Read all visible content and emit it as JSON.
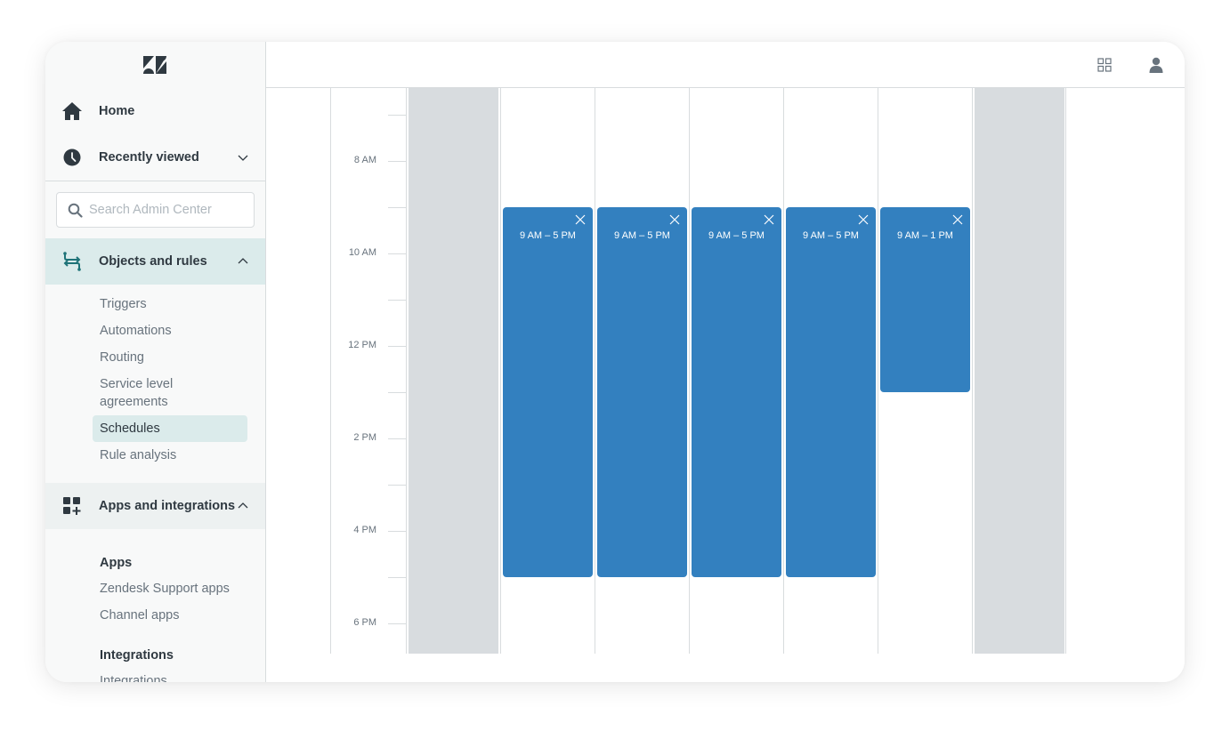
{
  "app": {
    "logo": "zendesk-logo",
    "colors": {
      "accent": "#3380bf",
      "sidebar_bg": "#f8f9f9",
      "active_section_bg": "#dbebeb",
      "off_day_bg": "#d8dcdf",
      "text_primary": "#2f3941",
      "text_secondary": "#68737d"
    }
  },
  "sidebar": {
    "home": {
      "label": "Home",
      "icon": "home-icon"
    },
    "recently_viewed": {
      "label": "Recently viewed",
      "icon": "clock-icon",
      "expanded": false
    },
    "search": {
      "placeholder": "Search Admin Center",
      "value": ""
    },
    "objects_and_rules": {
      "label": "Objects and rules",
      "icon": "objects-rules-icon",
      "expanded": true,
      "items": [
        {
          "label": "Triggers"
        },
        {
          "label": "Automations"
        },
        {
          "label": "Routing"
        },
        {
          "label": "Service level agreements"
        },
        {
          "label": "Schedules",
          "selected": true
        },
        {
          "label": "Rule analysis"
        }
      ]
    },
    "apps_and_integrations": {
      "label": "Apps and integrations",
      "icon": "apps-add-icon",
      "expanded": true,
      "groups": [
        {
          "heading": "Apps",
          "items": [
            {
              "label": "Zendesk Support apps"
            },
            {
              "label": "Channel apps"
            }
          ]
        },
        {
          "heading": "Integrations",
          "items": [
            {
              "label": "Integrations"
            }
          ]
        }
      ]
    }
  },
  "header": {
    "products_icon": "grid-icon",
    "profile_icon": "user-icon"
  },
  "calendar": {
    "hour_labels": [
      "8 AM",
      "10 AM",
      "12 PM",
      "2 PM",
      "4 PM",
      "6 PM"
    ],
    "visible_start_hour": 6.42,
    "days": [
      {
        "index": 0,
        "off": true
      },
      {
        "index": 1,
        "off": false
      },
      {
        "index": 2,
        "off": false
      },
      {
        "index": 3,
        "off": false
      },
      {
        "index": 4,
        "off": false
      },
      {
        "index": 5,
        "off": false
      },
      {
        "index": 6,
        "off": true
      }
    ],
    "events": [
      {
        "day": 1,
        "label": "9 AM – 5 PM",
        "start": 9,
        "end": 17
      },
      {
        "day": 2,
        "label": "9 AM – 5 PM",
        "start": 9,
        "end": 17
      },
      {
        "day": 3,
        "label": "9 AM – 5 PM",
        "start": 9,
        "end": 17
      },
      {
        "day": 4,
        "label": "9 AM – 5 PM",
        "start": 9,
        "end": 17
      },
      {
        "day": 5,
        "label": "9 AM – 1 PM",
        "start": 9,
        "end": 13
      }
    ]
  }
}
